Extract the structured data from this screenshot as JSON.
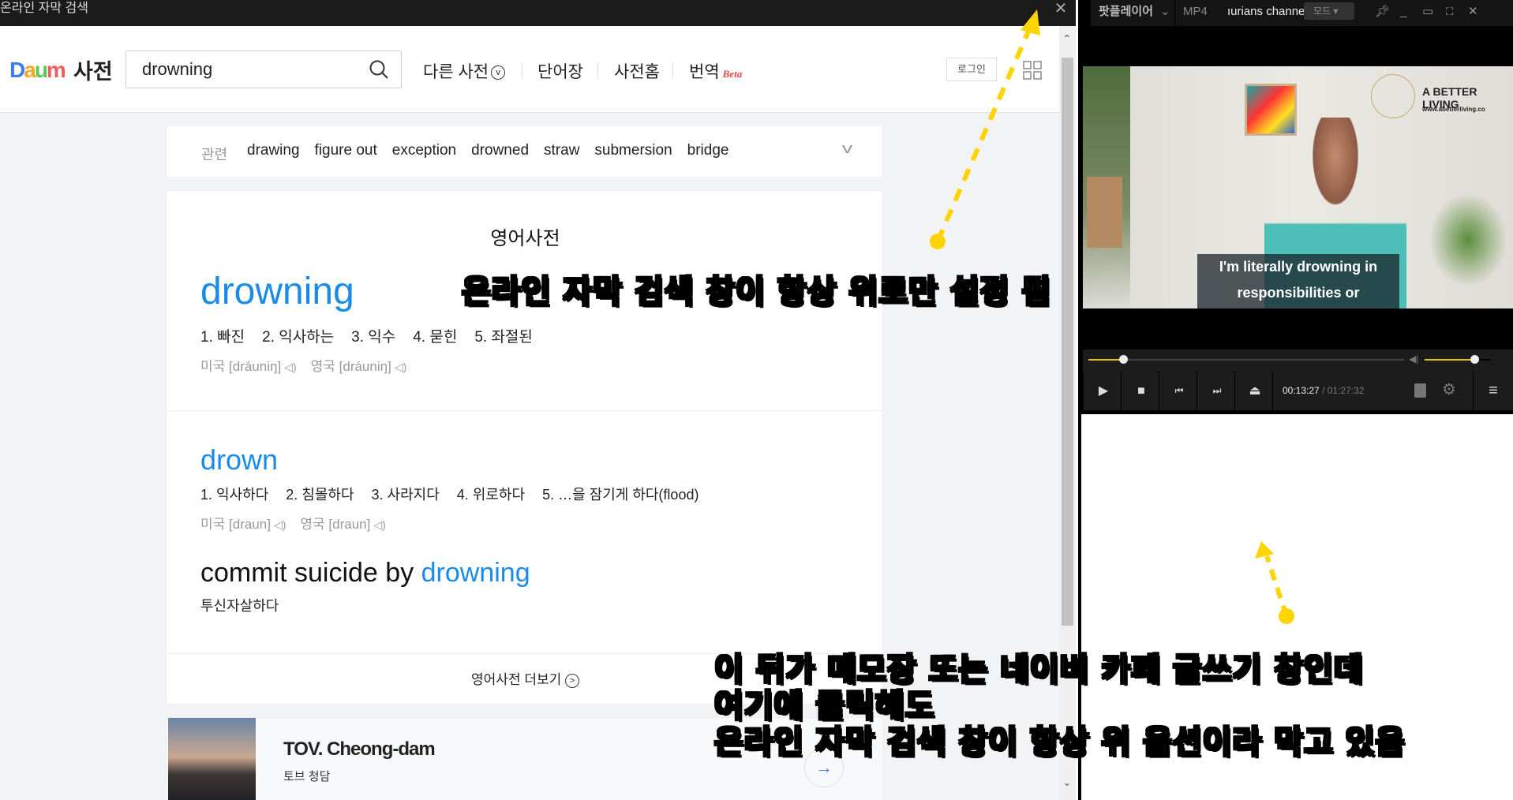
{
  "dict_window": {
    "title": "온라인 자막 검색",
    "close": "✕"
  },
  "header": {
    "logo": [
      "D",
      "a",
      "u",
      "m"
    ],
    "logo_suffix": "사전",
    "search_value": "drowning",
    "nav": [
      "다른 사전",
      "단어장",
      "사전홈",
      "번역"
    ],
    "beta": "Beta",
    "login": "로그인"
  },
  "related": {
    "label": "관련",
    "items": [
      "drawing",
      "figure out",
      "exception",
      "drowned",
      "straw",
      "submersion",
      "bridge"
    ]
  },
  "main": {
    "section_title": "영어사전",
    "entries": [
      {
        "word": "drowning",
        "meanings": [
          "1. 빠진",
          "2. 익사하는",
          "3. 익수",
          "4. 묻힌",
          "5. 좌절된"
        ],
        "us": "미국",
        "us_pron": "[dráuniŋ]",
        "uk": "영국",
        "uk_pron": "[dráuniŋ]"
      },
      {
        "word": "drown",
        "meanings": [
          "1. 익사하다",
          "2. 침몰하다",
          "3. 사라지다",
          "4. 위로하다",
          "5. …을 잠기게 하다(flood)"
        ],
        "us": "미국",
        "us_pron": "[draun]",
        "uk": "영국",
        "uk_pron": "[draun]"
      }
    ],
    "phrase_prefix": "commit suicide by ",
    "phrase_word": "drowning",
    "phrase_meaning": "투신자살하다",
    "more": "영어사전 더보기"
  },
  "ad": {
    "title": "TOV. Cheong-dam",
    "subtitle": "토브 청담"
  },
  "player": {
    "app": "팟플레이어",
    "format": "MP4",
    "file": "ıurians channe",
    "mode": "모드",
    "video_brand": "A BETTER LIVING",
    "video_url": "www.abetterliving.co",
    "subtitle": [
      "I'm literally drowning in",
      "responsibilities or"
    ],
    "time_current": "00:13:27",
    "time_total": "01:27:32",
    "seek_progress": 0.11,
    "volume": 0.75
  },
  "annotations": {
    "top": "온라인 자막 검색 창이 항상 위로만 설정 됨",
    "bottom": [
      "이 뒤가 메모장 또는 네이버 카페 글쓰기 창인데",
      "여기에 클릭해도",
      "온라인 자막 검색 창이 항상 위 옵션이라 막고 있음"
    ],
    "color": "#ffd400"
  }
}
